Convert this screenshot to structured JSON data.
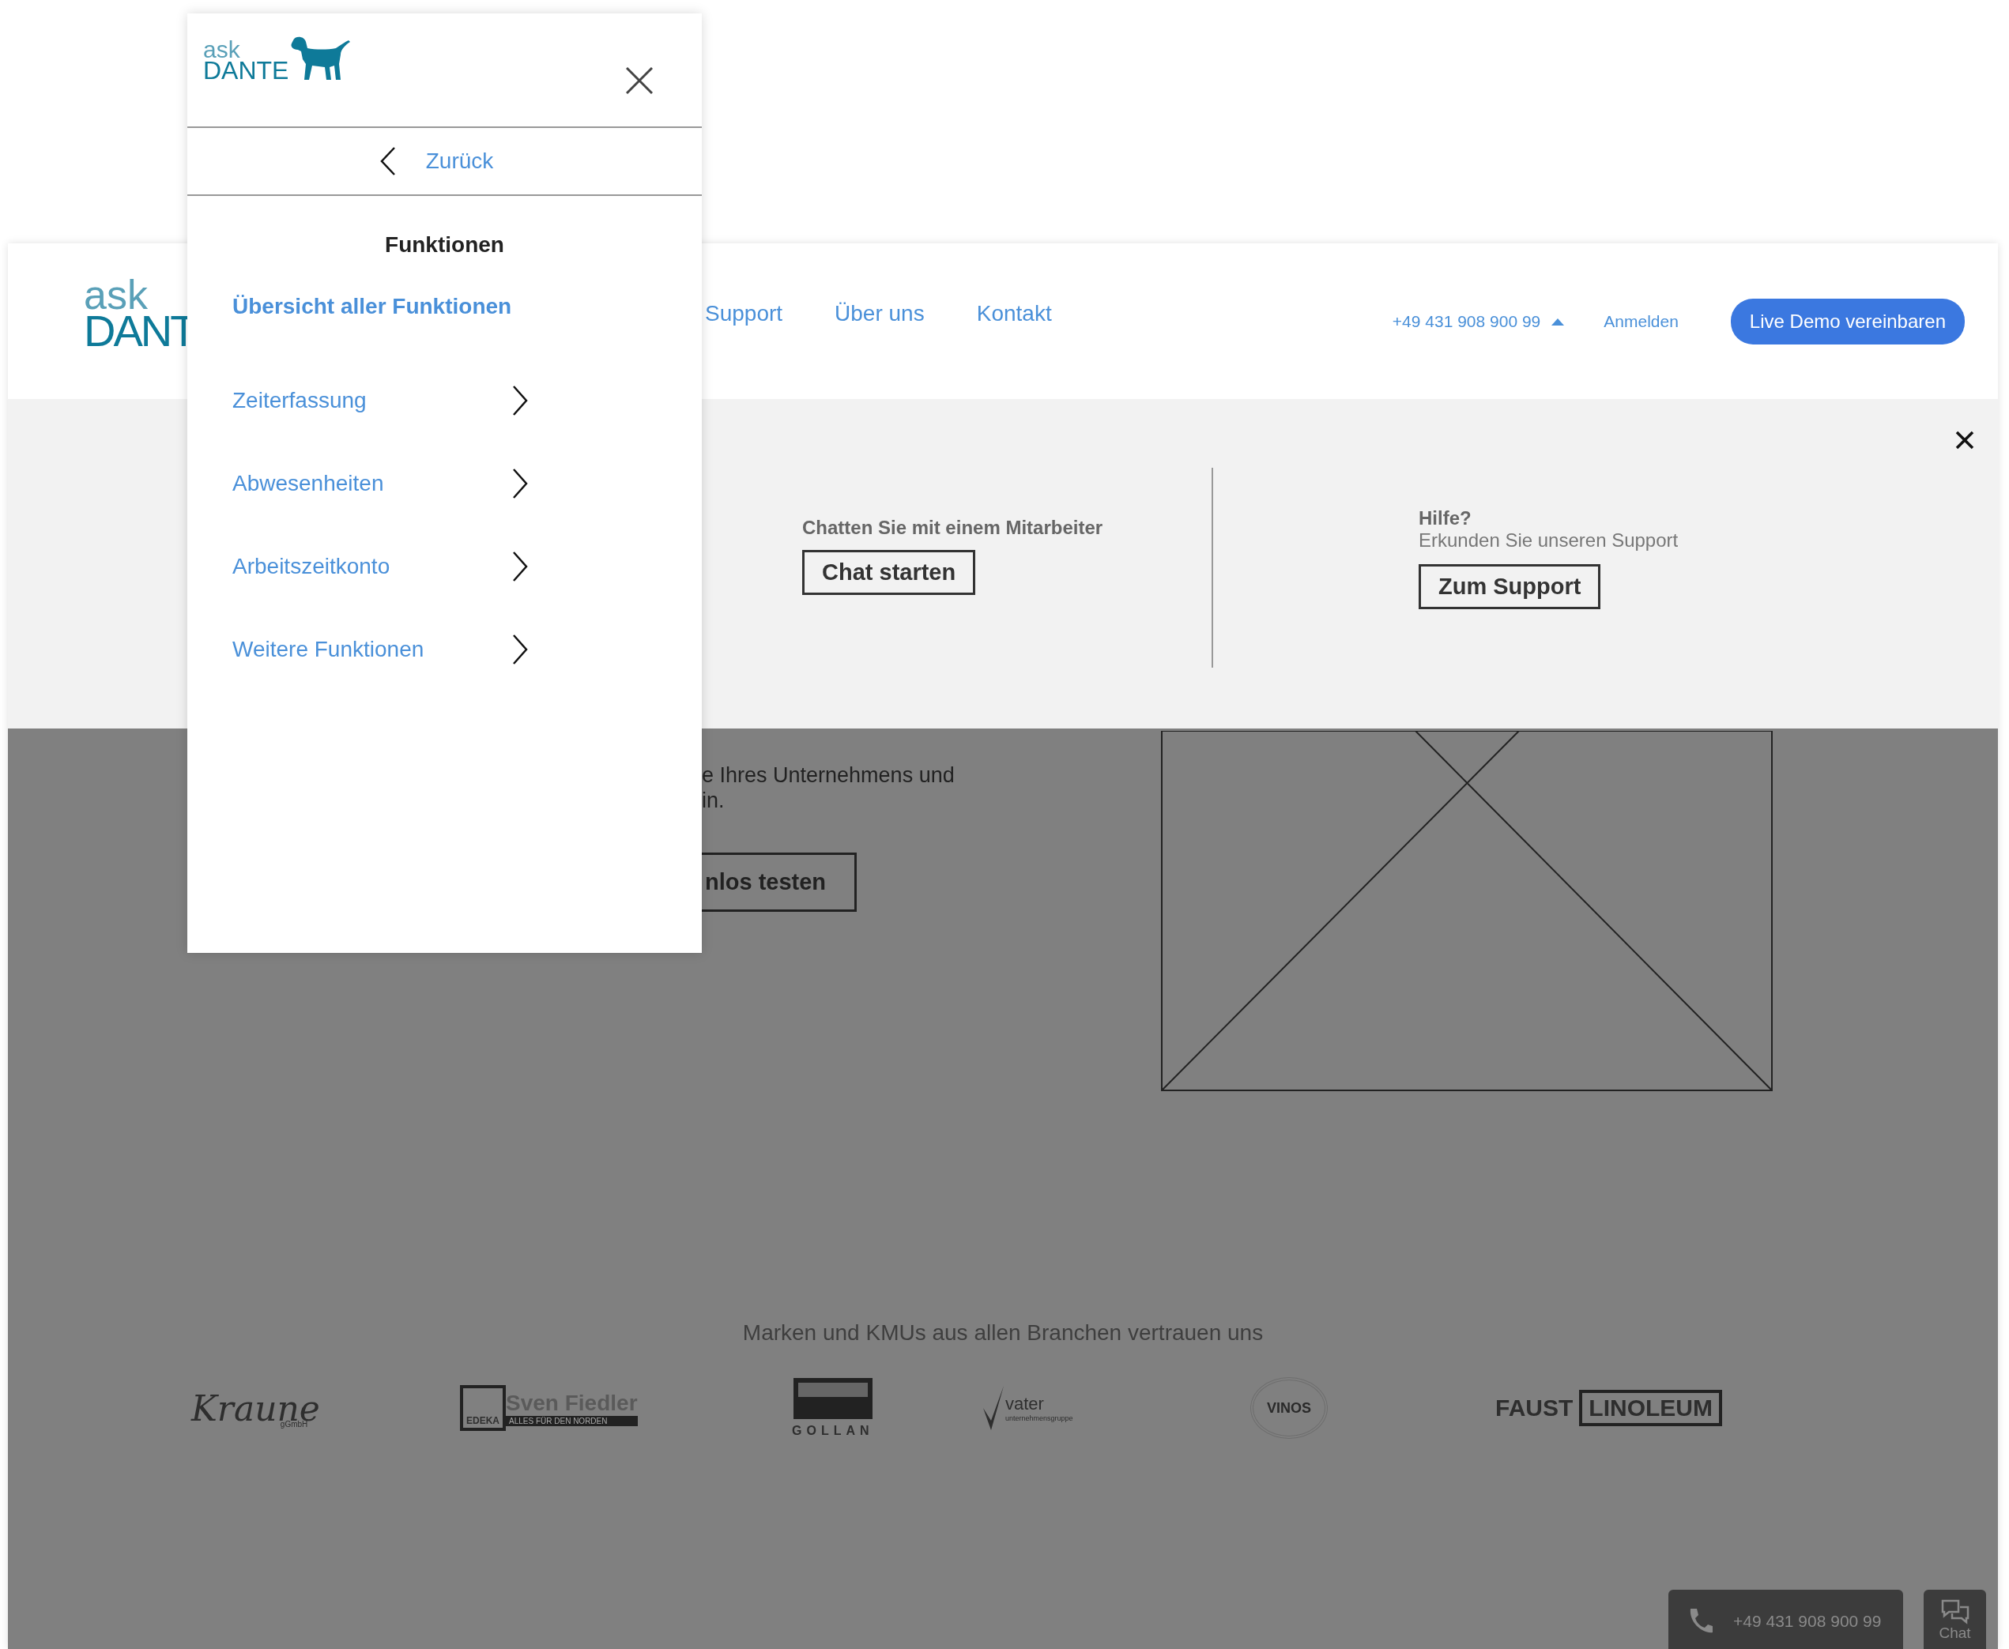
{
  "menu_panel": {
    "logo": {
      "top": "ask",
      "bottom": "DANTE"
    },
    "back_label": "Zurück",
    "heading": "Funktionen",
    "items": [
      {
        "label": "Übersicht aller Funktionen",
        "kind": "overview"
      },
      {
        "label": "Zeiterfassung",
        "kind": "submenu"
      },
      {
        "label": "Abwesenheiten",
        "kind": "submenu"
      },
      {
        "label": "Arbeitszeitkonto",
        "kind": "submenu"
      },
      {
        "label": "Weitere Funktionen",
        "kind": "submenu"
      }
    ]
  },
  "header": {
    "logo": {
      "top": "ask",
      "bottom": "DANT"
    },
    "nav": [
      "Support",
      "Über uns",
      "Kontakt"
    ],
    "phone": "+49 431 908 900 99",
    "login": "Anmelden",
    "cta": "Live Demo vereinbaren"
  },
  "contact_panel": {
    "chat": {
      "text": "Chatten Sie mit einem Mitarbeiter",
      "button": "Chat starten"
    },
    "help": {
      "title": "Hilfe?",
      "text": "Erkunden Sie unseren Support",
      "button": "Zum Support"
    }
  },
  "hero": {
    "text_lines": [
      "e Ihres Unternehmens und",
      "in."
    ],
    "button": "nlos testen"
  },
  "trust": {
    "heading": "Marken und KMUs aus allen Branchen vertrauen uns",
    "logos": [
      {
        "kind": "script",
        "name": "Kraune",
        "sub": "gGmbH"
      },
      {
        "kind": "edeka",
        "mark": "EDEKA",
        "name": "Sven Fiedler",
        "sub": "ALLES FÜR DEN NORDEN"
      },
      {
        "kind": "block",
        "name": "GOLLAN"
      },
      {
        "kind": "check",
        "name": "vater",
        "sub": "unternehmensgruppe"
      },
      {
        "kind": "seal",
        "name": "VINOS"
      },
      {
        "kind": "boxed",
        "name": "FAUST",
        "boxed": "LINOLEUM"
      }
    ]
  },
  "bottom_bar": {
    "phone": "+49 431 908 900 99",
    "chat": "Chat"
  }
}
